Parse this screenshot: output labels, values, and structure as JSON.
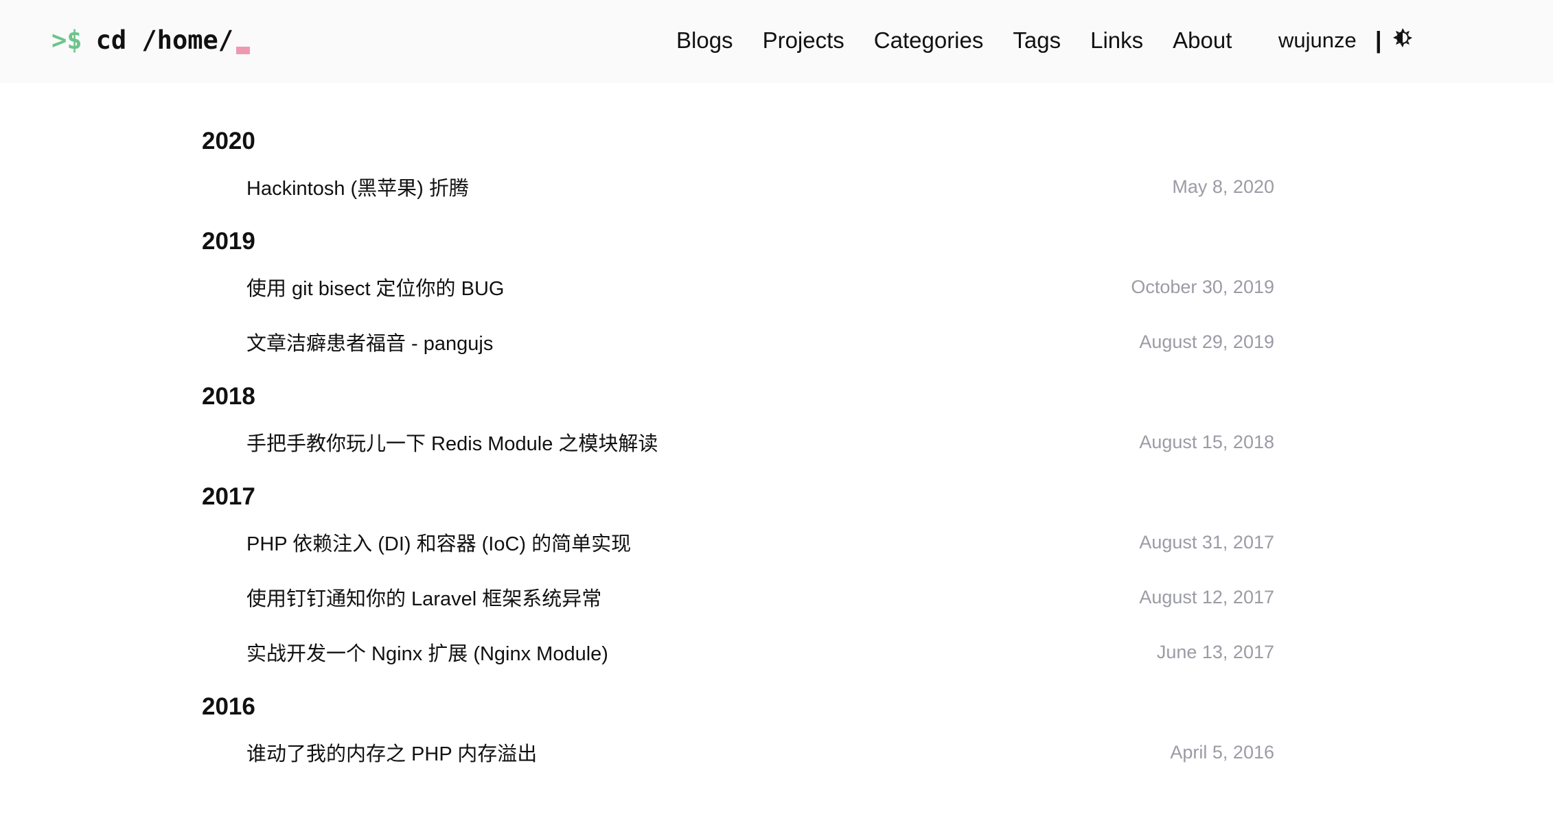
{
  "header": {
    "logo_prompt": ">$",
    "logo_path": "cd /home/",
    "nav": [
      "Blogs",
      "Projects",
      "Categories",
      "Tags",
      "Links",
      "About"
    ],
    "user": "wujunze",
    "separator": "|",
    "theme_icon": "theme-toggle-icon"
  },
  "archive": [
    {
      "year": "2020",
      "posts": [
        {
          "title": "Hackintosh (黑苹果) 折腾",
          "date": "May 8, 2020"
        }
      ]
    },
    {
      "year": "2019",
      "posts": [
        {
          "title": "使用 git bisect 定位你的 BUG",
          "date": "October 30, 2019"
        },
        {
          "title": "文章洁癖患者福音 - pangujs",
          "date": "August 29, 2019"
        }
      ]
    },
    {
      "year": "2018",
      "posts": [
        {
          "title": "手把手教你玩儿一下 Redis Module 之模块解读",
          "date": "August 15, 2018"
        }
      ]
    },
    {
      "year": "2017",
      "posts": [
        {
          "title": "PHP 依赖注入 (DI) 和容器 (IoC) 的简单实现",
          "date": "August 31, 2017"
        },
        {
          "title": "使用钉钉通知你的 Laravel 框架系统异常",
          "date": "August 12, 2017"
        },
        {
          "title": "实战开发一个 Nginx 扩展 (Nginx Module)",
          "date": "June 13, 2017"
        }
      ]
    },
    {
      "year": "2016",
      "posts": [
        {
          "title": "谁动了我的内存之 PHP 内存溢出",
          "date": "April 5, 2016"
        }
      ]
    }
  ]
}
